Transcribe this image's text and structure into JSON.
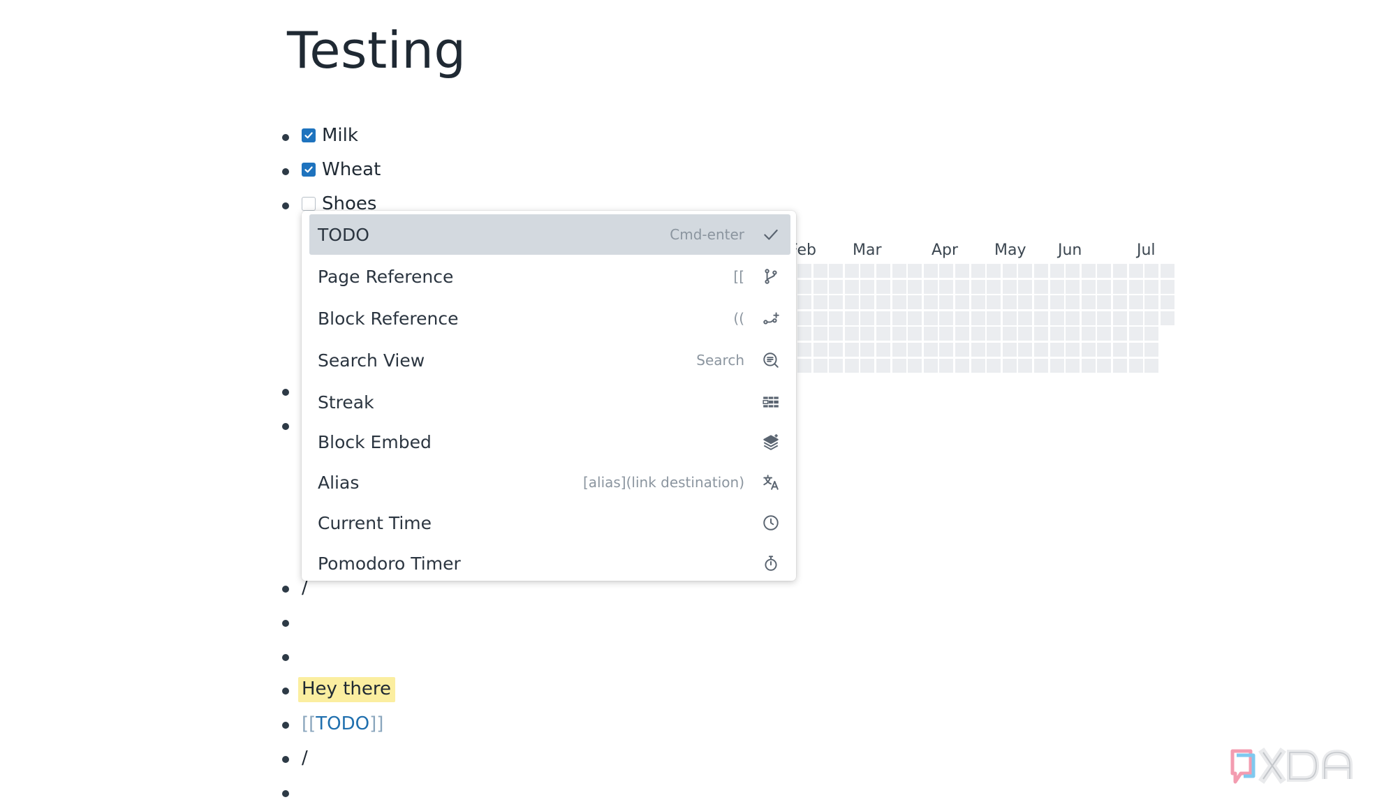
{
  "page": {
    "title": "Testing"
  },
  "blocks": {
    "todo_milk": "Milk",
    "todo_wheat": "Wheat",
    "todo_shoes": "Shoes",
    "slash_1": "/",
    "highlight_text": "Hey there",
    "ref_open": "[[",
    "ref_text": "TODO",
    "ref_close": "]]",
    "slash_2": "/"
  },
  "streak": {
    "months": [
      "Feb",
      "Mar",
      "Apr",
      "May",
      "Jun",
      "Jul"
    ],
    "cell_color": "#ebedf0"
  },
  "menu": {
    "items": [
      {
        "label": "TODO",
        "shortcut": "Cmd-enter",
        "icon": "check-icon",
        "selected": true
      },
      {
        "label": "Page Reference",
        "shortcut": "[[",
        "icon": "git-branch-icon"
      },
      {
        "label": "Block Reference",
        "shortcut": "((",
        "icon": "git-branch-plus-icon"
      },
      {
        "label": "Search View",
        "shortcut": "Search",
        "icon": "search-list-icon"
      },
      {
        "label": "Streak",
        "shortcut": "",
        "icon": "table-grid-icon"
      },
      {
        "label": "Block Embed",
        "shortcut": "",
        "icon": "layers-icon"
      },
      {
        "label": "Alias",
        "shortcut": "[alias](link destination)",
        "icon": "translate-icon"
      },
      {
        "label": "Current Time",
        "shortcut": "",
        "icon": "clock-icon"
      },
      {
        "label": "Pomodoro Timer",
        "shortcut": "",
        "icon": "stopwatch-icon"
      }
    ]
  },
  "colors": {
    "checkbox_checked": "#1e73be",
    "highlight_yellow": "#fbeea0",
    "menu_selected": "#d3d9df",
    "link_blue": "#1f6fae"
  },
  "watermark": {
    "text": "XDA"
  }
}
